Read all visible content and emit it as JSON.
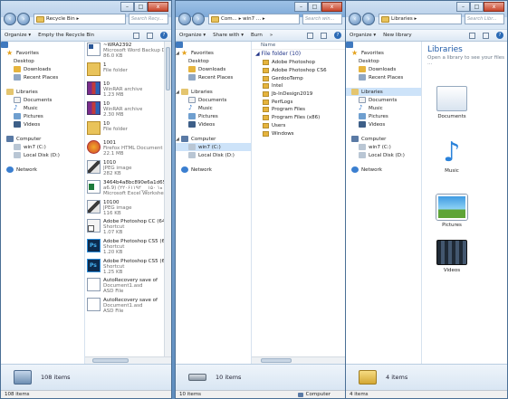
{
  "w1": {
    "address": [
      "Recycle Bin",
      "▸"
    ],
    "search": "Search Recy...",
    "toolbar": {
      "organize": "Organize ▾",
      "empty": "Empty the Recycle Bin"
    },
    "nav": {
      "favorites": "Favorites",
      "desktop": "Desktop",
      "downloads": "Downloads",
      "recent": "Recent Places",
      "libraries": "Libraries",
      "documents": "Documents",
      "music": "Music",
      "pictures": "Pictures",
      "videos": "Videos",
      "computer": "Computer",
      "c": "win7 (C:)",
      "d": "Local Disk (D:)",
      "network": "Network"
    },
    "tiles": [
      {
        "kind": "word",
        "name": "~WRA2392",
        "t1": "Microsoft Word Backup D...",
        "t2": "86.0 KB"
      },
      {
        "kind": "fold",
        "name": "1",
        "t1": "File folder",
        "t2": ""
      },
      {
        "kind": "rar",
        "name": "10",
        "t1": "WinRAR archive",
        "t2": "1.23 MB"
      },
      {
        "kind": "rar",
        "name": "10",
        "t1": "WinRAR archive",
        "t2": "2.30 MB"
      },
      {
        "kind": "fold",
        "name": "10",
        "t1": "File folder",
        "t2": ""
      },
      {
        "kind": "ff",
        "name": "1001",
        "t1": "Firefox HTML Document",
        "t2": "22.1 MB"
      },
      {
        "kind": "jpg",
        "name": "1010",
        "t1": "JPEG image",
        "t2": "282 KB"
      },
      {
        "kind": "xls",
        "name": "3464b4a8bc890e6a1d65e",
        "t1": "a6.9) (۲۲۰۶۱۱۹۲_ _ه۱ ۱۵۰",
        "t2": "Microsoft Excel Worksheet"
      },
      {
        "kind": "jpg",
        "name": "10100",
        "t1": "JPEG image",
        "t2": "116 KB"
      },
      {
        "kind": "lnk",
        "name": "Adobe Photoshop CC (64",
        "t1": "Shortcut",
        "t2": "1.07 KB"
      },
      {
        "kind": "ps",
        "name": "Adobe Photoshop CS5 (6",
        "t1": "Shortcut",
        "t2": "1.20 KB"
      },
      {
        "kind": "ps",
        "name": "Adobe Photoshop CS5 (6",
        "t1": "Shortcut",
        "t2": "1.25 KB"
      },
      {
        "kind": "asd",
        "name": "AutoRecovery save of",
        "t1": "Document1.asd",
        "t2": "ASD File"
      },
      {
        "kind": "asd",
        "name": "AutoRecovery save of",
        "t1": "Document1.asd",
        "t2": "ASD File"
      }
    ],
    "details": "108 items",
    "status": "108 items"
  },
  "w2": {
    "address": [
      "Com...",
      "▸",
      "win7 ...",
      "▸"
    ],
    "search": "Search win...",
    "toolbar": {
      "organize": "Organize ▾",
      "share": "Share with ▾",
      "burn": "Burn",
      "more": "»"
    },
    "nav": {
      "favorites": "Favorites",
      "desktop": "Desktop",
      "downloads": "Downloads",
      "recent": "Recent Places",
      "libraries": "Libraries",
      "documents": "Documents",
      "music": "Music",
      "pictures": "Pictures",
      "videos": "Videos",
      "computer": "Computer",
      "c": "win7 (C:)",
      "d": "Local Disk (D:)",
      "network": "Network"
    },
    "column": "Name",
    "group": "File folder (10)",
    "folders": [
      "Adobe Photoshop",
      "Adobe Photoshop CS6",
      "GerdooTemp",
      "Intel",
      "Jb-InDesign2019",
      "PerfLogs",
      "Program Files",
      "Program Files (x86)",
      "Users",
      "Windows"
    ],
    "details": "10 items",
    "status": "10 items",
    "status_right": "Computer"
  },
  "w3": {
    "address": [
      "Libraries",
      "▸"
    ],
    "search": "Search Libr...",
    "toolbar": {
      "organize": "Organize ▾",
      "newlib": "New library"
    },
    "nav": {
      "favorites": "Favorites",
      "desktop": "Desktop",
      "downloads": "Downloads",
      "recent": "Recent Places",
      "libraries": "Libraries",
      "documents": "Documents",
      "music": "Music",
      "pictures": "Pictures",
      "videos": "Videos",
      "computer": "Computer",
      "c": "win7 (C:)",
      "d": "Local Disk (D:)",
      "network": "Network"
    },
    "title": "Libraries",
    "subtitle": "Open a library to see your files ...",
    "libs": [
      "Documents",
      "Music",
      "Pictures",
      "Videos"
    ],
    "details": "4 items",
    "status": "4 items"
  },
  "caps": {
    "min": "–",
    "max": "□",
    "close": "x"
  }
}
